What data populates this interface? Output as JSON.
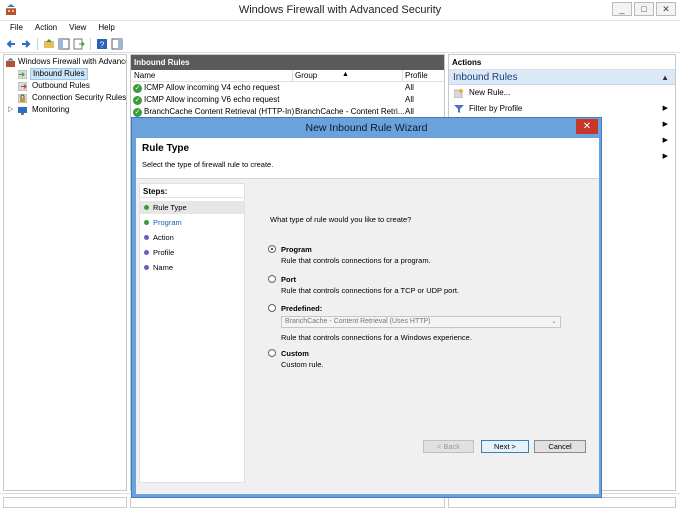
{
  "window": {
    "title": "Windows Firewall with Advanced Security"
  },
  "menu": [
    "File",
    "Action",
    "View",
    "Help"
  ],
  "tree": {
    "root": "Windows Firewall with Advance",
    "items": [
      "Inbound Rules",
      "Outbound Rules",
      "Connection Security Rules",
      "Monitoring"
    ]
  },
  "center": {
    "header": "Inbound Rules",
    "columns": {
      "name": "Name",
      "group": "Group",
      "profile": "Profile"
    },
    "rows": [
      {
        "name": "ICMP Allow incoming V4 echo request",
        "group": "",
        "profile": "All"
      },
      {
        "name": "ICMP Allow incoming V6 echo request",
        "group": "",
        "profile": "All"
      },
      {
        "name": "BranchCache Content Retrieval (HTTP-In)",
        "group": "BranchCache - Content Retri...",
        "profile": "All"
      }
    ]
  },
  "actions": {
    "header": "Actions",
    "section": "Inbound Rules",
    "items": [
      {
        "label": "New Rule..."
      },
      {
        "label": "Filter by Profile"
      }
    ]
  },
  "wizard": {
    "title": "New Inbound Rule Wizard",
    "close": "✕",
    "heading": "Rule Type",
    "subheading": "Select the type of firewall rule to create.",
    "steps_label": "Steps:",
    "steps": [
      "Rule Type",
      "Program",
      "Action",
      "Profile",
      "Name"
    ],
    "question": "What type of rule would you like to create?",
    "options": [
      {
        "label": "Program",
        "desc": "Rule that controls connections for a program.",
        "selected": true
      },
      {
        "label": "Port",
        "desc": "Rule that controls connections for a TCP or UDP port.",
        "selected": false
      },
      {
        "label": "Predefined:",
        "desc": "Rule that controls connections for a Windows experience.",
        "selected": false
      },
      {
        "label": "Custom",
        "desc": "Custom rule.",
        "selected": false
      }
    ],
    "predefined_value": "BranchCache - Content Retrieval (Uses HTTP)",
    "buttons": {
      "back": "< Back",
      "next": "Next >",
      "cancel": "Cancel"
    }
  }
}
